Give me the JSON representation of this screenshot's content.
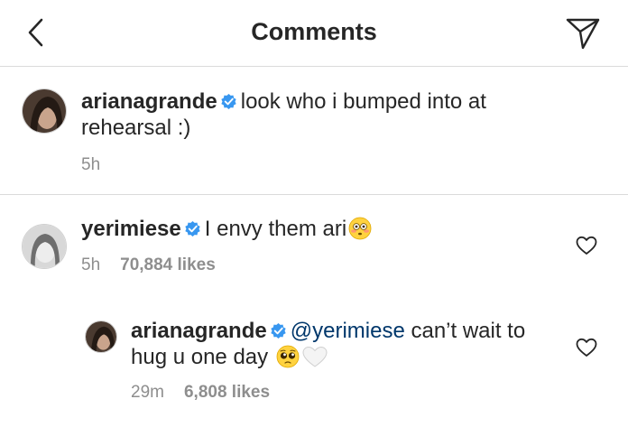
{
  "header": {
    "title": "Comments"
  },
  "caption": {
    "username": "arianagrande",
    "text": "look who i bumped into at rehearsal :)",
    "time": "5h"
  },
  "comments": [
    {
      "username": "yerimiese",
      "text": "I envy them ari",
      "emoji": "flushed-face",
      "time": "5h",
      "likes": "70,884 likes"
    }
  ],
  "replies": [
    {
      "username": "arianagrande",
      "mention": "@yerimiese",
      "text_line1": "can’t wait to",
      "text_line2": "hug u one day",
      "emojis": [
        "pleading-face",
        "white-heart"
      ],
      "time": "29m",
      "likes": "6,808 likes"
    }
  ],
  "colors": {
    "verified": "#3897f0",
    "mention": "#00376b",
    "meta": "#8e8e8e",
    "divider": "#dbdbdb"
  }
}
